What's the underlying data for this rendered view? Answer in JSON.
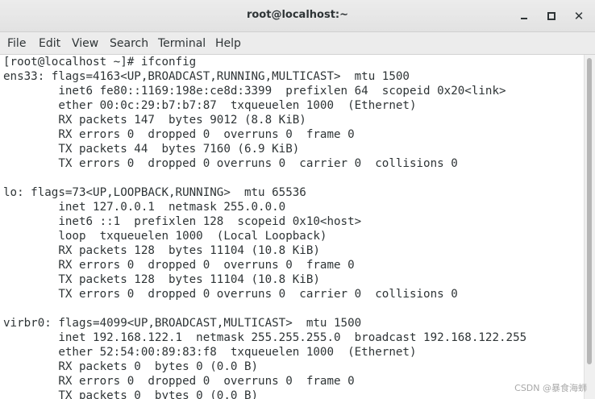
{
  "window": {
    "title": "root@localhost:~",
    "minimize_label": "",
    "maximize_label": "",
    "close_label": "✕"
  },
  "menu": [
    "File",
    "Edit",
    "View",
    "Search",
    "Terminal",
    "Help"
  ],
  "terminal": {
    "lines": [
      "[root@localhost ~]# ifconfig",
      "ens33: flags=4163<UP,BROADCAST,RUNNING,MULTICAST>  mtu 1500",
      "        inet6 fe80::1169:198e:ce8d:3399  prefixlen 64  scopeid 0x20<link>",
      "        ether 00:0c:29:b7:b7:87  txqueuelen 1000  (Ethernet)",
      "        RX packets 147  bytes 9012 (8.8 KiB)",
      "        RX errors 0  dropped 0  overruns 0  frame 0",
      "        TX packets 44  bytes 7160 (6.9 KiB)",
      "        TX errors 0  dropped 0 overruns 0  carrier 0  collisions 0",
      "",
      "lo: flags=73<UP,LOOPBACK,RUNNING>  mtu 65536",
      "        inet 127.0.0.1  netmask 255.0.0.0",
      "        inet6 ::1  prefixlen 128  scopeid 0x10<host>",
      "        loop  txqueuelen 1000  (Local Loopback)",
      "        RX packets 128  bytes 11104 (10.8 KiB)",
      "        RX errors 0  dropped 0  overruns 0  frame 0",
      "        TX packets 128  bytes 11104 (10.8 KiB)",
      "        TX errors 0  dropped 0 overruns 0  carrier 0  collisions 0",
      "",
      "virbr0: flags=4099<UP,BROADCAST,MULTICAST>  mtu 1500",
      "        inet 192.168.122.1  netmask 255.255.255.0  broadcast 192.168.122.255",
      "        ether 52:54:00:89:83:f8  txqueuelen 1000  (Ethernet)",
      "        RX packets 0  bytes 0 (0.0 B)",
      "        RX errors 0  dropped 0  overruns 0  frame 0",
      "        TX packets 0  bytes 0 (0.0 B)"
    ]
  },
  "watermark": "CSDN @暴食海蛳",
  "icons": {
    "minimize": "minimize-icon",
    "maximize": "maximize-icon",
    "close": "close-icon"
  }
}
